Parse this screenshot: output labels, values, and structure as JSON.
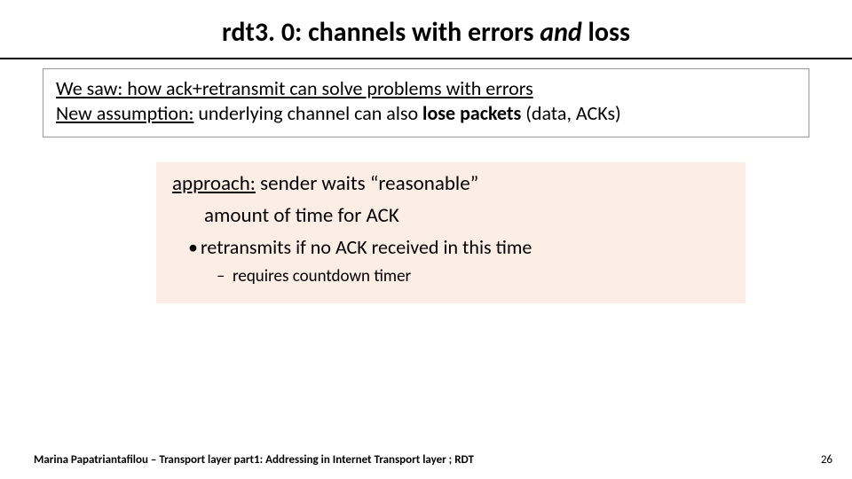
{
  "title": {
    "pre": "rdt3. 0: channels with errors ",
    "italic": "and",
    "post": " loss"
  },
  "box1": {
    "line1_u": "We saw: how ack+retransmit can solve problems with errors",
    "line2_u": "New assumption:",
    "line2_rest_pre": " underlying channel can also ",
    "line2_bold": "lose packets",
    "line2_rest_post": " (data, ACKs)"
  },
  "box2": {
    "approach_label": "approach:",
    "approach_rest1": " sender waits ",
    "approach_quote": "“reasonable”",
    "approach_cont": "amount of time for ACK",
    "bullet1": "retransmits if no ACK received in this time",
    "bullet2": "requires countdown timer"
  },
  "footer": "Marina Papatriantafilou – Transport layer part1: Addressing in Internet Transport layer ; RDT",
  "pagenum": "26"
}
